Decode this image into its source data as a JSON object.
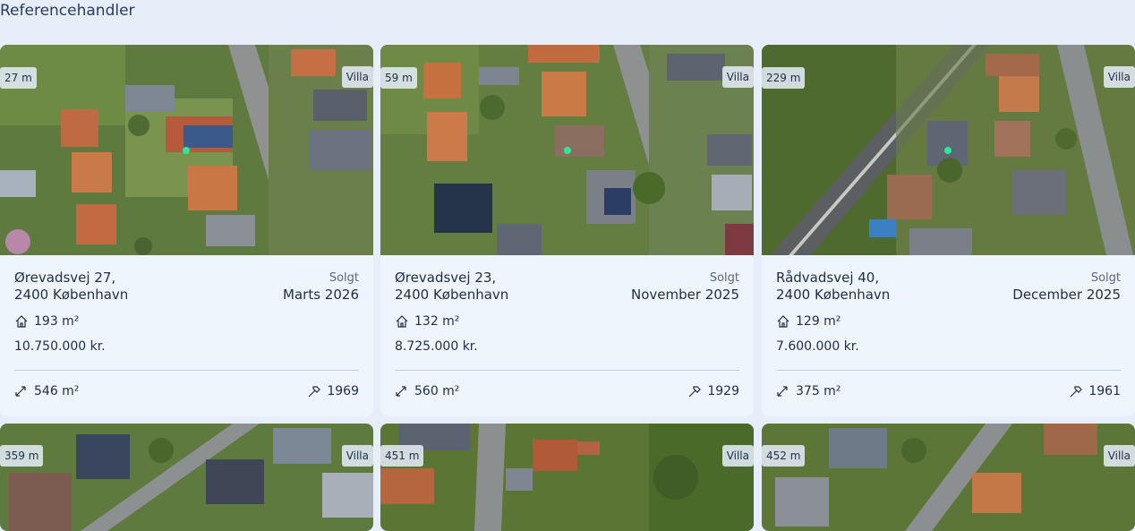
{
  "page": {
    "title": "Referencehandler"
  },
  "cards": [
    {
      "distance": "27 m",
      "type": "Villa",
      "address_line1": "Ørevadsvej 27,",
      "address_line2": "2400 København",
      "status": "Solgt",
      "date": "Marts 2026",
      "area": "193 m²",
      "price": "10.750.000 kr.",
      "plot": "546 m²",
      "year": "1969"
    },
    {
      "distance": "59 m",
      "type": "Villa",
      "address_line1": "Ørevadsvej 23,",
      "address_line2": "2400 København",
      "status": "Solgt",
      "date": "November 2025",
      "area": "132 m²",
      "price": "8.725.000 kr.",
      "plot": "560 m²",
      "year": "1929"
    },
    {
      "distance": "229 m",
      "type": "Villa",
      "address_line1": "Rådvadsvej 40,",
      "address_line2": "2400 København",
      "status": "Solgt",
      "date": "December 2025",
      "area": "129 m²",
      "price": "7.600.000 kr.",
      "plot": "375 m²",
      "year": "1961"
    },
    {
      "distance": "359 m",
      "type": "Villa"
    },
    {
      "distance": "451 m",
      "type": "Villa"
    },
    {
      "distance": "452 m",
      "type": "Villa"
    }
  ],
  "icons": {
    "area": "house-icon",
    "plot": "expand-arrows-icon",
    "year": "hammer-icon"
  },
  "colors": {
    "background": "#e6eefa",
    "card": "#eff5fd",
    "text": "#1f2d4a",
    "marker": "#2ee89a"
  }
}
